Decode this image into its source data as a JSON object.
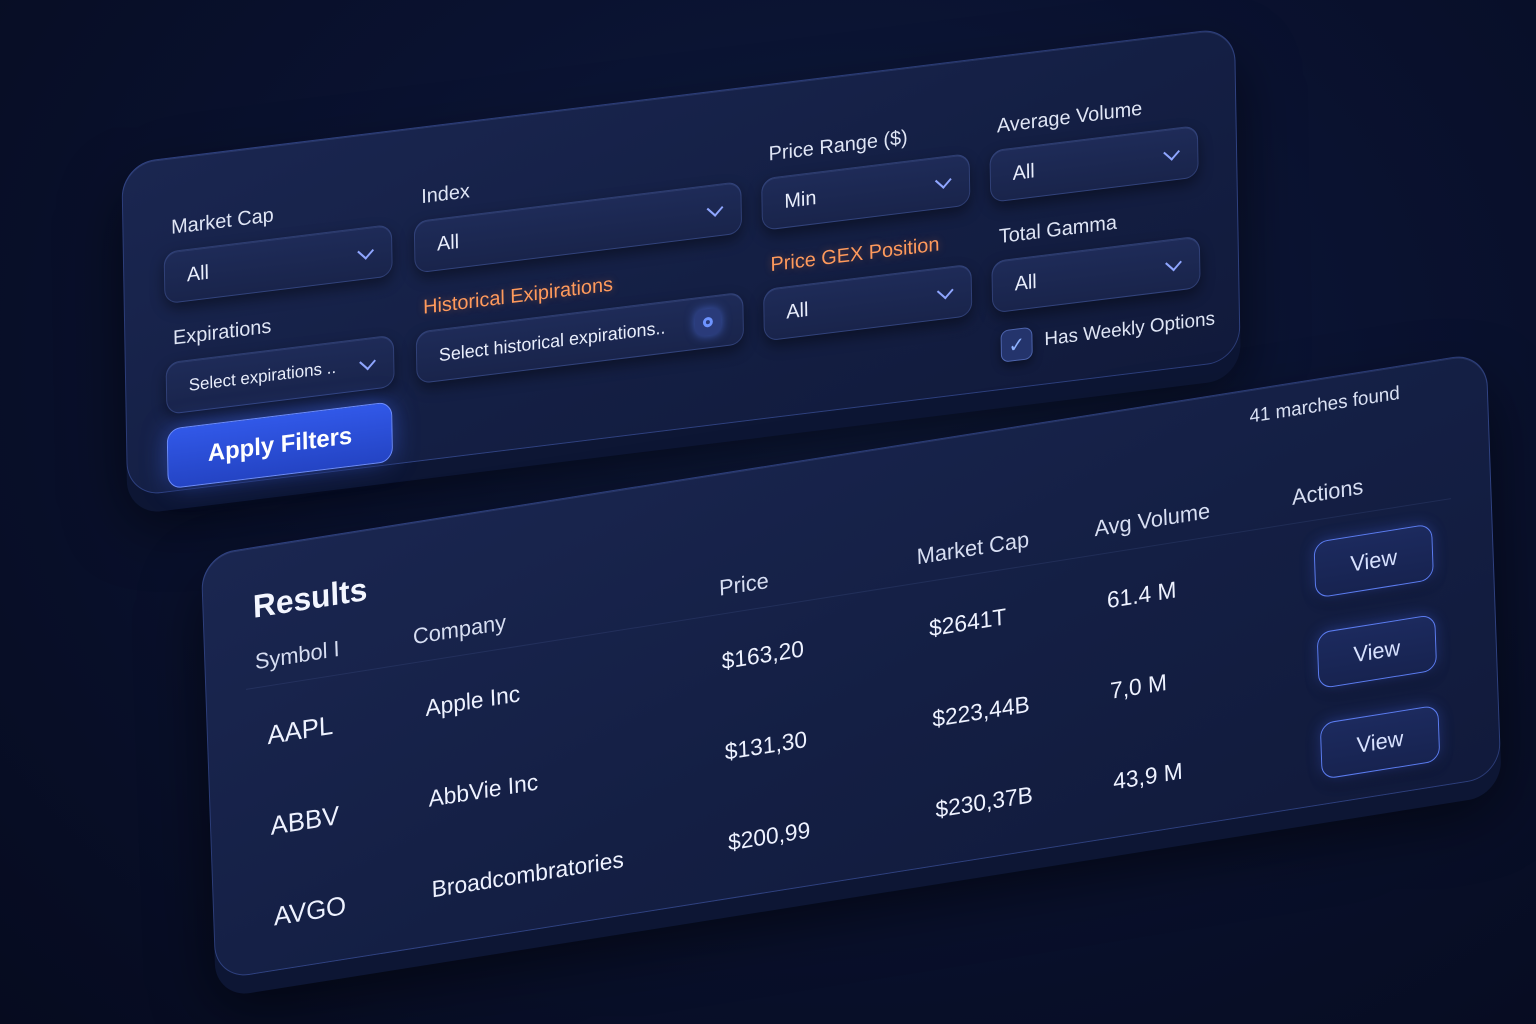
{
  "filters": {
    "market_cap": {
      "label": "Market Cap",
      "value": "All"
    },
    "index": {
      "label": "Index",
      "value": "All"
    },
    "price_range": {
      "label": "Price Range ($)",
      "value": "Min"
    },
    "average_volume": {
      "label": "Average Volume",
      "value": "All"
    },
    "expirations": {
      "label": "Expirations",
      "placeholder": "Select expirations .."
    },
    "historical_expirations": {
      "label": "Historical Exipirations",
      "placeholder": "Select historical expirations.."
    },
    "price_gex_position": {
      "label": "Price GEX Position",
      "value": "All"
    },
    "total_gamma": {
      "label": "Total Gamma",
      "value": "All"
    },
    "weekly_options": {
      "label": "Has Weekly Options",
      "checked": true
    },
    "apply_label": "Apply Filters"
  },
  "results": {
    "title": "Results",
    "match_count": "41 marches found",
    "columns": [
      "Symbol I",
      "Company",
      "Price",
      "Market Cap",
      "Avg Volume",
      "Actions"
    ],
    "rows": [
      {
        "symbol": "AAPL",
        "company": "Apple Inc",
        "price": "$163,20",
        "market_cap": "$2641T",
        "avg_volume": "61.4 M",
        "action": "View"
      },
      {
        "symbol": "ABBV",
        "company": "AbbVie Inc",
        "price": "$131,30",
        "market_cap": "$223,44B",
        "avg_volume": "7,0 M",
        "action": "View"
      },
      {
        "symbol": "AVGO",
        "company": "Broadcombratories",
        "price": "$200,99",
        "market_cap": "$230,37B",
        "avg_volume": "43,9 M",
        "action": "View"
      }
    ]
  },
  "colors": {
    "background": "#0a1230",
    "panel": "#1a2650",
    "accent": "#3158e8",
    "highlight_label": "#ff9a5c"
  },
  "icons": [
    "chevron-down-icon",
    "radio-icon",
    "check-icon"
  ]
}
